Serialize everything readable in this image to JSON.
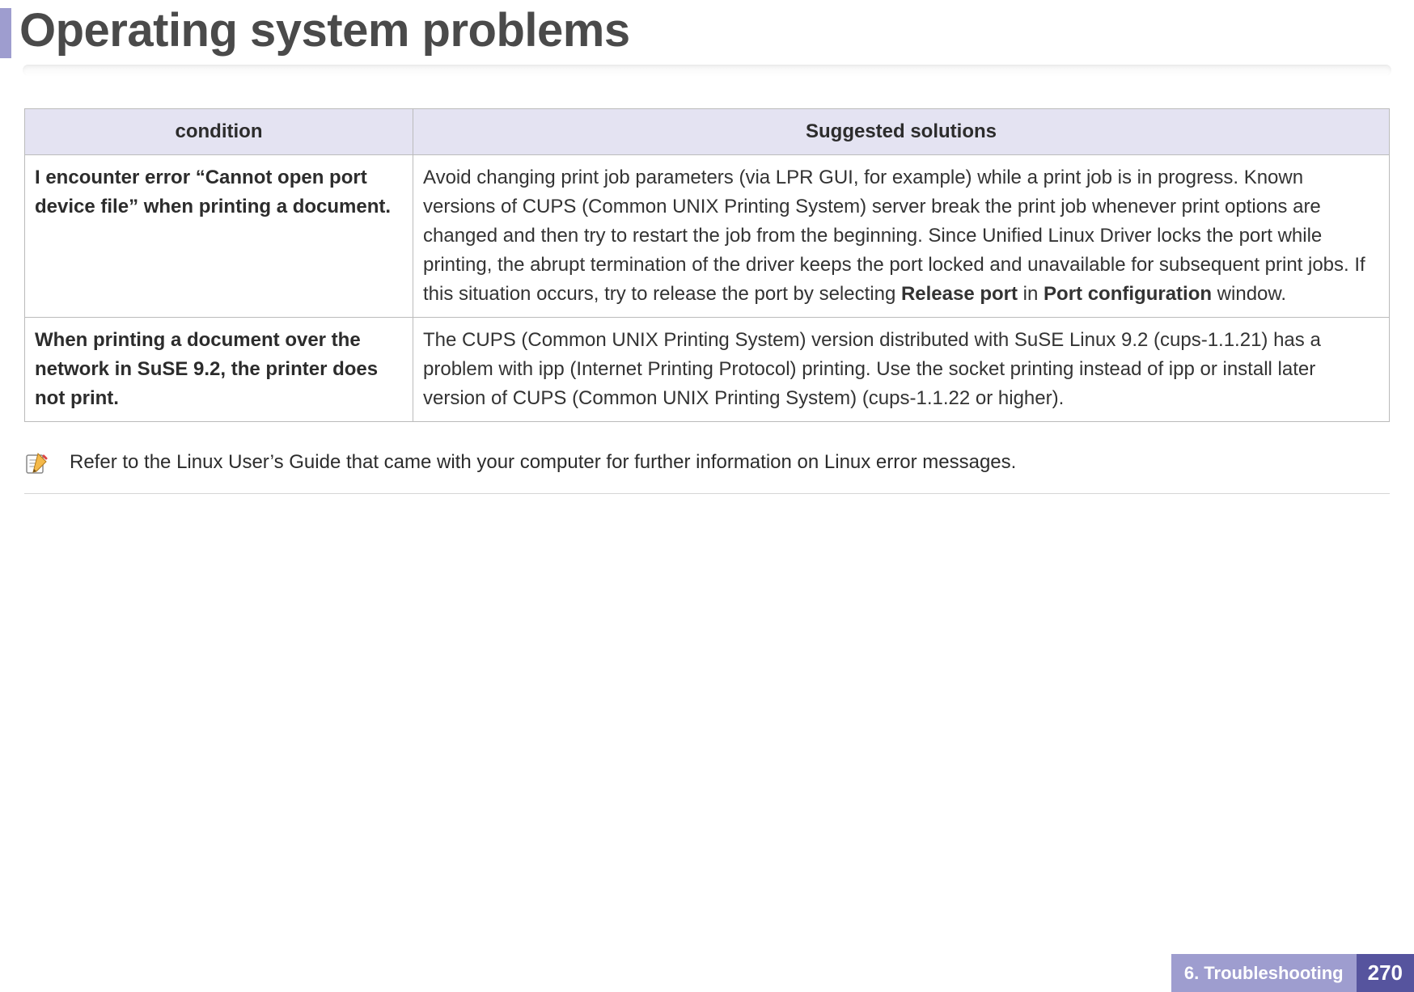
{
  "title": "Operating system problems",
  "table": {
    "headers": {
      "condition": "condition",
      "solution": "Suggested solutions"
    },
    "rows": [
      {
        "condition": "I encounter error “Cannot open port device file” when printing a document.",
        "solution_html": "Avoid changing print job parameters (via LPR GUI, for example) while a print job is in progress. Known versions of CUPS (Common UNIX Printing System) server break the print job whenever print options are changed and then try to restart the job from the beginning. Since Unified Linux Driver locks the port while printing, the abrupt termination of the driver keeps the port locked and unavailable for subsequent print jobs. If this situation occurs, try to release the port by selecting <span class=\"b\">Release port</span> in <span class=\"b\">Port configuration</span> window."
      },
      {
        "condition": "When printing a document over the network in SuSE 9.2, the printer does not print.",
        "solution_html": "The CUPS (Common UNIX Printing System) version distributed with SuSE Linux 9.2 (cups-1.1.21) has a problem with ipp (Internet Printing Protocol) printing. Use the socket printing instead of ipp or install later version of CUPS (Common UNIX Printing System) (cups-1.1.22 or higher)."
      }
    ]
  },
  "note": "Refer to the Linux User’s Guide that came with your computer for further information on Linux error messages.",
  "footer": {
    "chapter": "6.  Troubleshooting",
    "page": "270"
  }
}
